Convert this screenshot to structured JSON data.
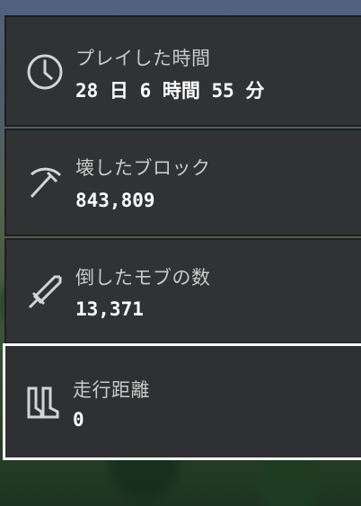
{
  "stats": [
    {
      "icon": "clock-icon",
      "label": "プレイした時間",
      "value": "28 日 6 時間 55 分"
    },
    {
      "icon": "pickaxe-icon",
      "label": "壊したブロック",
      "value": "843,809"
    },
    {
      "icon": "sword-icon",
      "label": "倒したモブの数",
      "value": "13,371"
    },
    {
      "icon": "boots-icon",
      "label": "走行距離",
      "value": "0"
    }
  ],
  "selected_index": 3,
  "colors": {
    "panel": "#313233",
    "label": "#c9c9c9",
    "value": "#ffffff",
    "selection_border": "#ffffff"
  }
}
